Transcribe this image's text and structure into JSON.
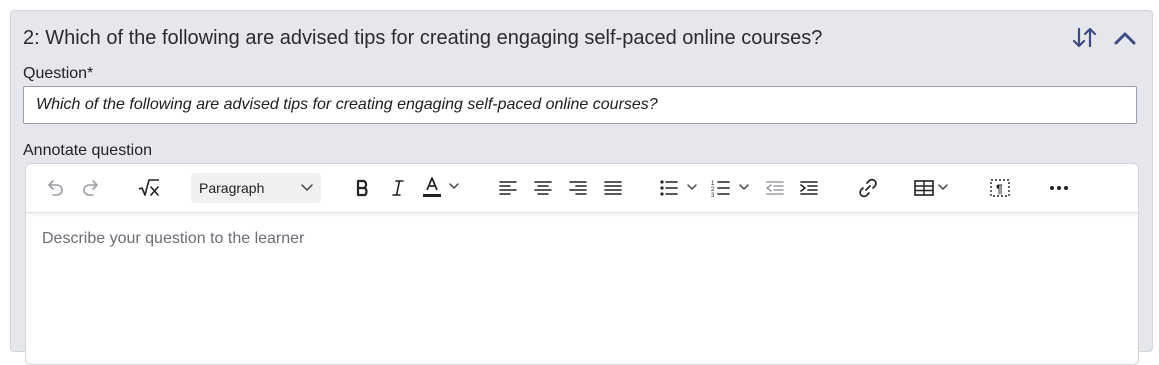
{
  "question_block": {
    "title": "2: Which of the following are advised tips for creating engaging self-paced online courses?",
    "reorder_icon": "sort-arrows-icon",
    "collapse_icon": "chevron-up-icon"
  },
  "question_field": {
    "label": "Question*",
    "value": "Which of the following are advised tips for creating engaging self-paced online courses?"
  },
  "annotate": {
    "label": "Annotate question",
    "placeholder": "Describe your question to the learner"
  },
  "toolbar": {
    "block_format": "Paragraph",
    "icons": [
      "undo-icon",
      "redo-icon",
      "math-formula-icon",
      "bold-icon",
      "italic-icon",
      "text-color-icon",
      "align-left-icon",
      "align-center-icon",
      "align-right-icon",
      "align-justify-icon",
      "bullet-list-icon",
      "numbered-list-icon",
      "outdent-icon",
      "indent-icon",
      "link-icon",
      "table-icon",
      "show-blocks-icon",
      "more-icon"
    ]
  },
  "colors": {
    "accent": "#3f4a84",
    "panel_bg": "#e6e7ec"
  }
}
